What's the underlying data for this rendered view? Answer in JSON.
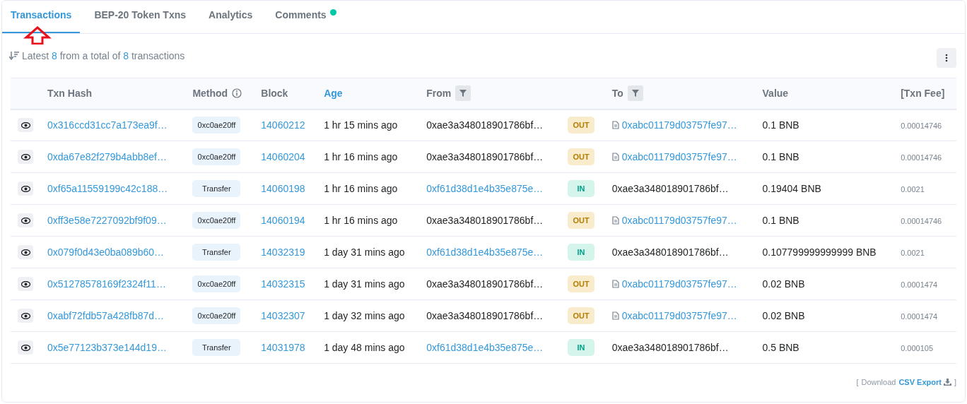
{
  "tabs": [
    {
      "label": "Transactions",
      "selected": true,
      "dot": false
    },
    {
      "label": "BEP-20 Token Txns",
      "selected": false,
      "dot": false
    },
    {
      "label": "Analytics",
      "selected": false,
      "dot": false
    },
    {
      "label": "Comments",
      "selected": false,
      "dot": true
    }
  ],
  "summary": {
    "prefix": "Latest",
    "shown": "8",
    "middle": "from a total of",
    "total": "8",
    "suffix": "transactions"
  },
  "columns": [
    {
      "label": "Txn Hash",
      "kind": "plain"
    },
    {
      "label": "Method",
      "kind": "info"
    },
    {
      "label": "Block",
      "kind": "plain"
    },
    {
      "label": "Age",
      "kind": "link"
    },
    {
      "label": "From",
      "kind": "filter"
    },
    {
      "label": "To",
      "kind": "filter"
    },
    {
      "label": "Value",
      "kind": "plain"
    },
    {
      "label": "[Txn Fee]",
      "kind": "plain"
    }
  ],
  "rows": [
    {
      "hash": "0x316ccd31cc7a173ea9f…",
      "method": "0xc0ae20ff",
      "block": "14060212",
      "age": "1 hr 15 mins ago",
      "from": "0xae3a348018901786bf…",
      "from_link": false,
      "direction": "OUT",
      "kind": "out",
      "to": "0xabc01179d03757fe97…",
      "to_link": true,
      "contract": true,
      "value": "0.1 BNB",
      "fee": "0.00014746"
    },
    {
      "hash": "0xda67e82f279b4abb8ef…",
      "method": "0xc0ae20ff",
      "block": "14060204",
      "age": "1 hr 16 mins ago",
      "from": "0xae3a348018901786bf…",
      "from_link": false,
      "direction": "OUT",
      "kind": "out",
      "to": "0xabc01179d03757fe97…",
      "to_link": true,
      "contract": true,
      "value": "0.1 BNB",
      "fee": "0.00014746"
    },
    {
      "hash": "0xf65a11559199c42c188…",
      "method": "Transfer",
      "block": "14060198",
      "age": "1 hr 16 mins ago",
      "from": "0xf61d38d1e4b35e875e…",
      "from_link": true,
      "direction": "IN",
      "kind": "in",
      "to": "0xae3a348018901786bf…",
      "to_link": false,
      "contract": false,
      "value": "0.19404 BNB",
      "fee": "0.0021"
    },
    {
      "hash": "0xff3e58e7227092bf9f09…",
      "method": "0xc0ae20ff",
      "block": "14060194",
      "age": "1 hr 16 mins ago",
      "from": "0xae3a348018901786bf…",
      "from_link": false,
      "direction": "OUT",
      "kind": "out",
      "to": "0xabc01179d03757fe97…",
      "to_link": true,
      "contract": true,
      "value": "0.1 BNB",
      "fee": "0.00014746"
    },
    {
      "hash": "0x079f0d43e0ba089b60…",
      "method": "Transfer",
      "block": "14032319",
      "age": "1 day 31 mins ago",
      "from": "0xf61d38d1e4b35e875e…",
      "from_link": true,
      "direction": "IN",
      "kind": "in",
      "to": "0xae3a348018901786bf…",
      "to_link": false,
      "contract": false,
      "value": "0.107799999999999 BNB",
      "fee": "0.0021"
    },
    {
      "hash": "0x51278578169f2324f11…",
      "method": "0xc0ae20ff",
      "block": "14032315",
      "age": "1 day 31 mins ago",
      "from": "0xae3a348018901786bf…",
      "from_link": false,
      "direction": "OUT",
      "kind": "out",
      "to": "0xabc01179d03757fe97…",
      "to_link": true,
      "contract": true,
      "value": "0.02 BNB",
      "fee": "0.0001474"
    },
    {
      "hash": "0xabf72fdb57a428fb87d…",
      "method": "0xc0ae20ff",
      "block": "14032307",
      "age": "1 day 32 mins ago",
      "from": "0xae3a348018901786bf…",
      "from_link": false,
      "direction": "OUT",
      "kind": "out",
      "to": "0xabc01179d03757fe97…",
      "to_link": true,
      "contract": true,
      "value": "0.02 BNB",
      "fee": "0.0001474"
    },
    {
      "hash": "0x5e77123b373e144d19…",
      "method": "Transfer",
      "block": "14031978",
      "age": "1 day 48 mins ago",
      "from": "0xf61d38d1e4b35e875e…",
      "from_link": true,
      "direction": "IN",
      "kind": "in",
      "to": "0xae3a348018901786bf…",
      "to_link": false,
      "contract": false,
      "value": "0.5 BNB",
      "fee": "0.000105"
    }
  ],
  "footer": {
    "open": "[",
    "text": "Download",
    "link": "CSV Export",
    "close": "]"
  }
}
